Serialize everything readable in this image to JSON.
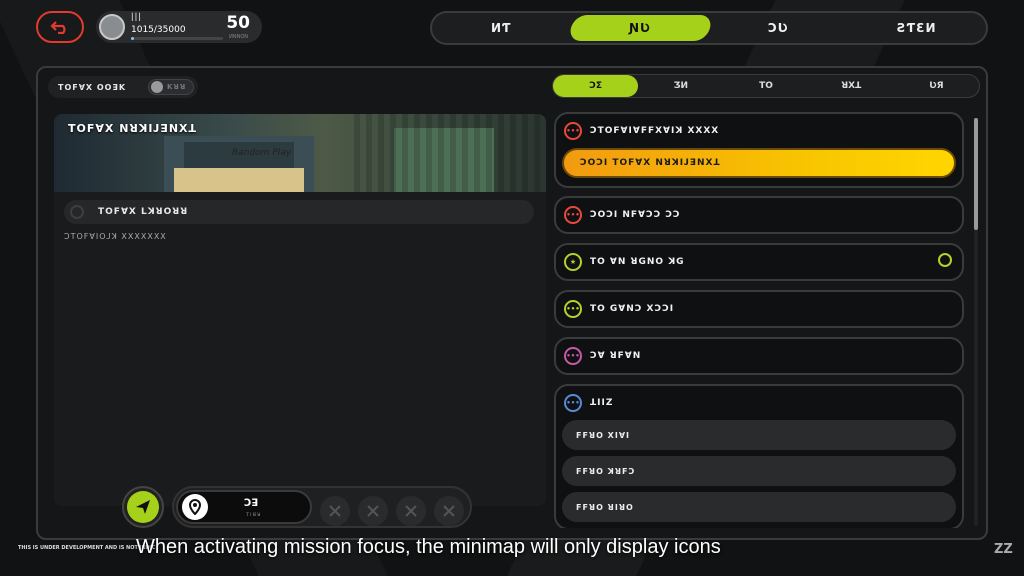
{
  "profile": {
    "name": "ꟾꟾꟾ",
    "exp": "1015/35000",
    "exp_fraction": 0.029,
    "level": "50",
    "level_label": "ИNNON"
  },
  "main_tabs": [
    "ИƬ",
    "ƝƲ",
    "ƆƲ",
    "ƧƬƐИ"
  ],
  "active_main_tab": 1,
  "focus": {
    "label": "ꓔꓳꓝꓯꓫ ꓳꓳꓱꓗ",
    "state": "ꓗꓤꓤ"
  },
  "sub_tabs": [
    "ƆƩ",
    "ƷИ",
    "ꓔꓳ",
    "ꓤꓫꓕ",
    "ƲЯ"
  ],
  "active_sub_tab": 0,
  "preview": {
    "title": "ꓔꓳꓝꓯꓫ ꓠꓤꓘꓲꓙꓱꓠꓫꓕ",
    "shop_sign": "Random Play",
    "selected": "ꓔꓳꓝꓯꓫ ꓡꓘꓤꓳꓤꓤ",
    "description": "ꓛꓔꓳꓝꓯꓲꓳꓙꓘ ꓫꓫꓫꓫꓫꓫꓫ"
  },
  "map_control": {
    "label": "ꓛꓱ",
    "sublabel": "ꓔꓲꓭꓤ"
  },
  "tasks": [
    {
      "title": "ꓛꓔꓳꓝꓯꓲꓯꓝꓝꓫꓯꓲꓘ ꓫꓫꓫꓫ",
      "icon_color": "#e84a3a",
      "highlight": "ꓛꓳꓛꓲ  ꓔꓳꓝꓯꓫ ꓠꓤꓘꓲꓙꓱꓠꓫꓕ"
    },
    {
      "title": "ꓛꓳꓛꓲ ꓠꓝꓯꓛꓛ ꓛꓛ",
      "icon_color": "#e84a3a"
    },
    {
      "title": "ꓔꓳ  ꓯꓠ ꓤꓖꓠꓳ  ꓘꓖ",
      "icon_color": "#b5d12a"
    },
    {
      "title": "ꓔꓳ ꓖꓯꓠꓛ ꓫꓛꓛꓲ",
      "icon_color": "#b5d12a"
    },
    {
      "title": "ꓛꓯ ꓤꓝꓯꓠ",
      "icon_color": "#c75aa8"
    },
    {
      "title": "ꓕꓲꓲꓜ",
      "icon_color": "#5a8ad6",
      "items": [
        "ꓝꓝꓤꓳ ꓫꓲꓯꓲ",
        "ꓝꓝꓤꓳ ꓘꓤꓝꓛ",
        "ꓝꓝꓤꓳ ꓤꓲꓤꓳ"
      ]
    }
  ],
  "footer": {
    "disclaimer": "THIS IS UNDER DEVELOPMENT AND IS NOT INDIC",
    "subtitle": "When activating mission focus, the minimap will only display icons",
    "logo": "ZZ"
  }
}
